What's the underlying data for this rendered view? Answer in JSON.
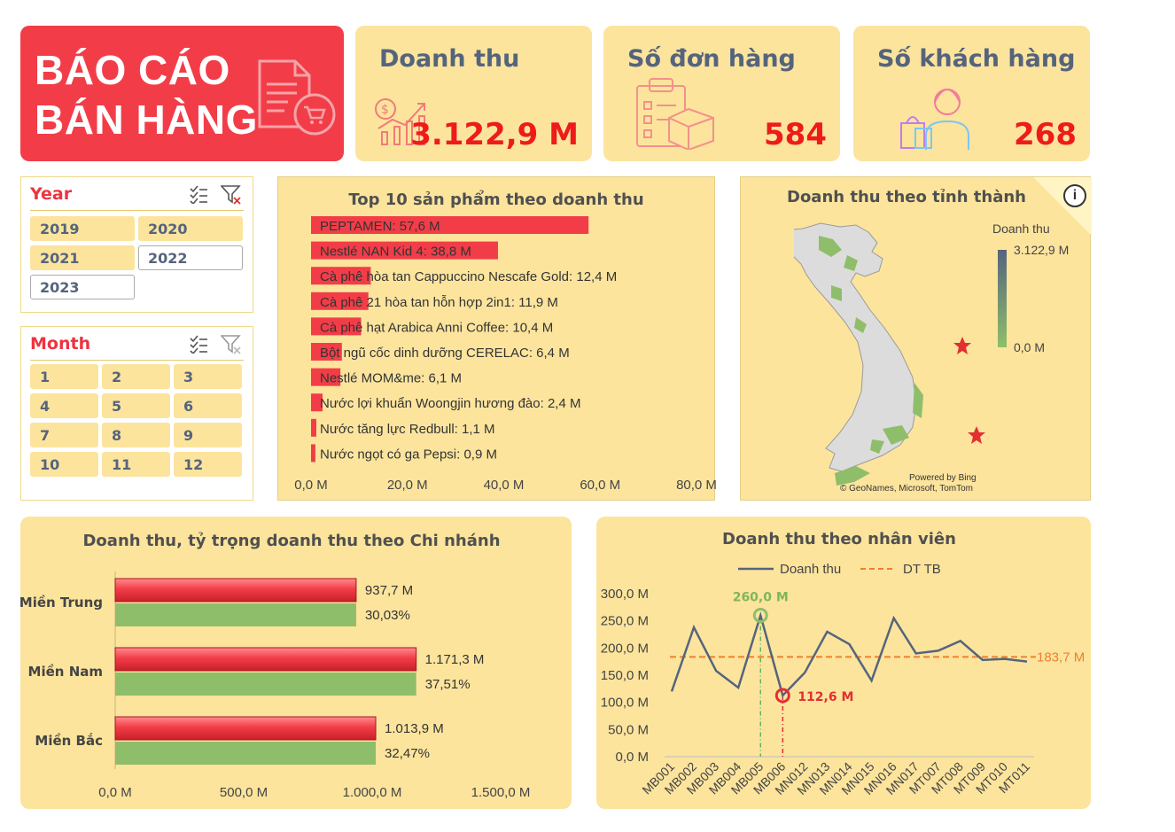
{
  "header": {
    "title_line1": "BÁO CÁO",
    "title_line2": "BÁN HÀNG"
  },
  "kpis": [
    {
      "label": "Doanh thu",
      "value": "3.122,9 M",
      "icon": "revenue-chart-icon"
    },
    {
      "label": "Số đơn hàng",
      "value": "584",
      "icon": "order-clipboard-icon"
    },
    {
      "label": "Số khách hàng",
      "value": "268",
      "icon": "customer-shopping-icon"
    }
  ],
  "year_slicer": {
    "title": "Year",
    "items": [
      {
        "label": "2019",
        "selected": true
      },
      {
        "label": "2020",
        "selected": true
      },
      {
        "label": "2021",
        "selected": true
      },
      {
        "label": "2022",
        "selected": false
      },
      {
        "label": "2023",
        "selected": false
      }
    ]
  },
  "month_slicer": {
    "title": "Month",
    "items": [
      "1",
      "2",
      "3",
      "4",
      "5",
      "6",
      "7",
      "8",
      "9",
      "10",
      "11",
      "12"
    ]
  },
  "colors": {
    "red": "#f23d48",
    "green": "#8fbe6a",
    "card": "#fce49d",
    "slate": "#55647d",
    "orange": "#f07f2b"
  },
  "top_products": {
    "title": "Top 10 sản phẩm theo doanh thu",
    "labels": [
      "PEPTAMEN: 57,6 M",
      "Nestlé NAN Kid 4: 38,8 M",
      "Cà phê hòa tan Cappuccino Nescafe Gold: 12,4 M",
      "Cà phê 21 hòa tan hỗn hợp 2in1: 11,9 M",
      "Cà phê hạt Arabica Anni Coffee: 10,4 M",
      "Bột ngũ cốc dinh dưỡng CERELAC: 6,4 M",
      "Nestlé MOM&me: 6,1 M",
      "Nước lợi khuẩn Woongjin hương đào: 2,4 M",
      "Nước tăng lực Redbull: 1,1 M",
      "Nước ngọt có ga Pepsi: 0,9 M"
    ],
    "ticks": [
      "0,0 M",
      "20,0 M",
      "40,0 M",
      "60,0 M",
      "80,0 M"
    ]
  },
  "map": {
    "title": "Doanh thu theo tỉnh thành",
    "legend_title": "Doanh thu",
    "legend_max": "3.122,9 M",
    "legend_min": "0,0 M",
    "credit1": "Powered by Bing",
    "credit2": "© GeoNames, Microsoft, TomTom",
    "info": "i"
  },
  "branch_chart": {
    "title": "Doanh thu, tỷ trọng doanh thu theo Chi nhánh",
    "ticks": [
      "0,0 M",
      "500,0 M",
      "1.000,0 M",
      "1.500,0 M"
    ],
    "value_labels": [
      "937,7 M",
      "1.171,3 M",
      "1.013,9 M"
    ],
    "share_labels": [
      "30,03%",
      "37,51%",
      "32,47%"
    ]
  },
  "employee_chart": {
    "title": "Doanh thu theo nhân viên",
    "legend_line": "Doanh thu",
    "legend_avg": "DT TB",
    "max_label": "260,0 M",
    "min_label": "112,6 M",
    "avg_label": "183,7 M",
    "yticks": [
      "300,0 M",
      "250,0 M",
      "200,0 M",
      "150,0 M",
      "100,0 M",
      "50,0 M",
      "0,0 M"
    ]
  },
  "chart_data": [
    {
      "type": "bar",
      "title": "Top 10 sản phẩm theo doanh thu",
      "categories": [
        "PEPTAMEN",
        "Nestlé NAN Kid 4",
        "Cà phê hòa tan Cappuccino Nescafe Gold",
        "Cà phê 21 hòa tan hỗn hợp 2in1",
        "Cà phê hạt Arabica Anni Coffee",
        "Bột ngũ cốc dinh dưỡng CERELAC",
        "Nestlé MOM&me",
        "Nước lợi khuẩn Woongjin hương đào",
        "Nước tăng lực Redbull",
        "Nước ngọt có ga Pepsi"
      ],
      "values": [
        57.6,
        38.8,
        12.4,
        11.9,
        10.4,
        6.4,
        6.1,
        2.4,
        1.1,
        0.9
      ],
      "xlim": [
        0,
        80
      ],
      "orientation": "horizontal"
    },
    {
      "type": "bar",
      "title": "Doanh thu, tỷ trọng doanh thu theo Chi nhánh",
      "categories": [
        "Miền Trung",
        "Miền Nam",
        "Miền Bắc"
      ],
      "series": [
        {
          "values": [
            937.7,
            1171.3,
            1013.9
          ]
        },
        {
          "values": [
            30.03,
            37.51,
            32.47
          ]
        }
      ],
      "xlim": [
        0,
        1500
      ],
      "orientation": "horizontal"
    },
    {
      "type": "line",
      "title": "Doanh thu theo nhân viên",
      "x": [
        "MB001",
        "MB002",
        "MB003",
        "MB004",
        "MB005",
        "MB006",
        "MN012",
        "MN013",
        "MN014",
        "MN015",
        "MN016",
        "MN017",
        "MT007",
        "MT008",
        "MT009",
        "MT010",
        "MT011"
      ],
      "series": [
        {
          "name": "Doanh thu",
          "values": [
            120,
            238,
            158,
            127,
            260,
            112.6,
            155,
            230,
            207,
            140,
            255,
            190,
            195,
            213,
            178,
            180,
            175
          ]
        },
        {
          "name": "DT TB",
          "values": [
            183.7,
            183.7,
            183.7,
            183.7,
            183.7,
            183.7,
            183.7,
            183.7,
            183.7,
            183.7,
            183.7,
            183.7,
            183.7,
            183.7,
            183.7,
            183.7,
            183.7
          ]
        }
      ],
      "ylim": [
        0,
        300
      ]
    }
  ]
}
